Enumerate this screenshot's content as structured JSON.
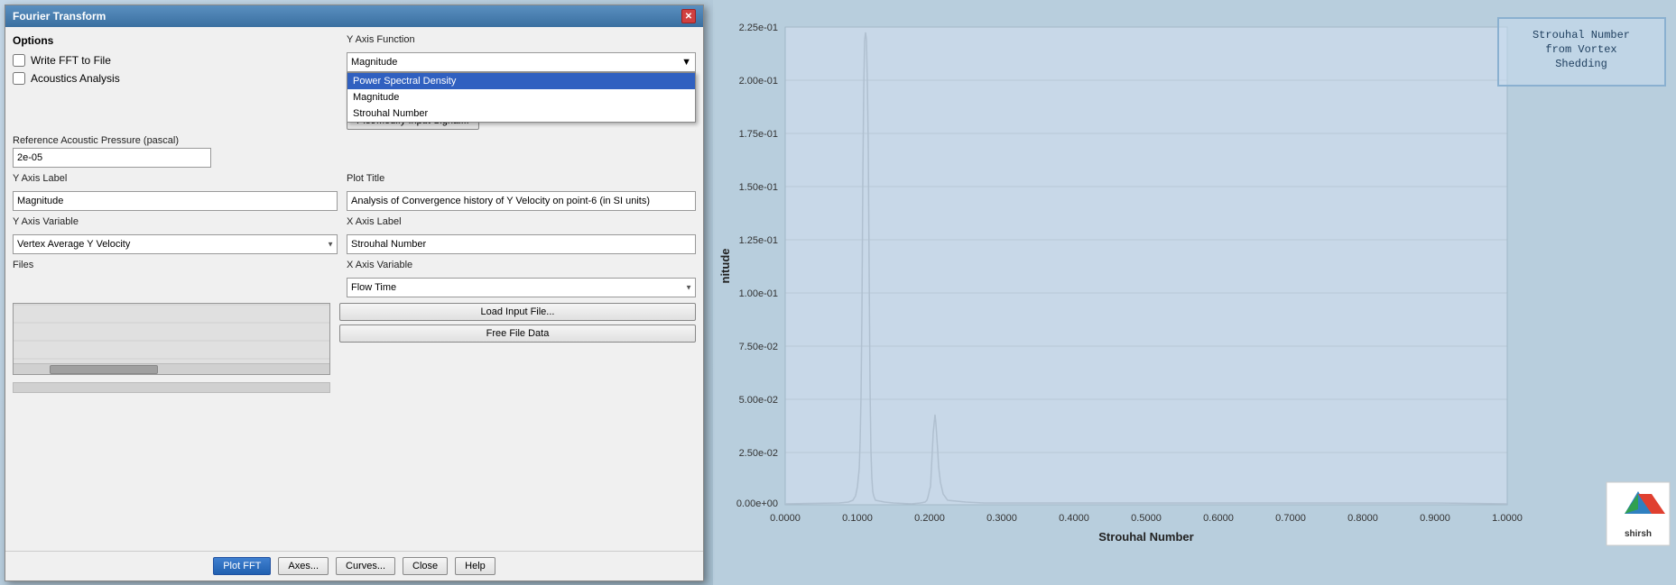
{
  "dialog": {
    "title": "Fourier Transform",
    "options": {
      "label": "Options",
      "write_fft": "Write FFT to File",
      "acoustics": "Acoustics Analysis"
    },
    "y_axis_function": {
      "label": "Y Axis Function",
      "current_value": "Magnitude",
      "dropdown_items": [
        {
          "label": "Power Spectral Density",
          "selected": true
        },
        {
          "label": "Magnitude",
          "selected": false
        },
        {
          "label": "Strouhal Number",
          "selected": false
        }
      ]
    },
    "plot_modify_btn": "Plot/Modify Input Signal...",
    "plot_title": {
      "label": "Plot Title",
      "value": "Analysis of Convergence history of Y Velocity on point-6 (in SI units)"
    },
    "x_axis_label": {
      "label": "X Axis Label",
      "value": "Strouhal Number"
    },
    "y_axis_label": {
      "label": "Y Axis Label",
      "value": "Magnitude"
    },
    "y_axis_variable": {
      "label": "Y Axis Variable",
      "value": "Vertex Average Y Velocity"
    },
    "x_axis_variable": {
      "label": "X Axis Variable",
      "value": "Flow Time"
    },
    "reference_pressure": {
      "label": "Reference Acoustic Pressure (pascal)",
      "value": "2e-05"
    },
    "files": {
      "label": "Files"
    },
    "load_input_btn": "Load Input File...",
    "free_file_btn": "Free File Data",
    "footer": {
      "plot_fft": "Plot FFT",
      "axes": "Axes...",
      "curves": "Curves...",
      "close": "Close",
      "help": "Help"
    }
  },
  "chart": {
    "y_axis_values": [
      "2.25e-01",
      "2.00e-01",
      "1.75e-01",
      "1.50e-01",
      "1.25e-01",
      "1.00e-01",
      "7.50e-02",
      "5.00e-02",
      "2.50e-02",
      "0.00e+00"
    ],
    "x_axis_values": [
      "0.0000",
      "0.1000",
      "0.2000",
      "0.3000",
      "0.4000",
      "0.5000",
      "0.6000",
      "0.7000",
      "0.8000",
      "0.9000",
      "1.0000"
    ],
    "x_axis_label": "Strouhal Number",
    "y_axis_label": "Magnitude",
    "annotation": "Strouhal Number\nfrom Vortex\nShedding"
  },
  "logo": {
    "label": "shirsh"
  }
}
